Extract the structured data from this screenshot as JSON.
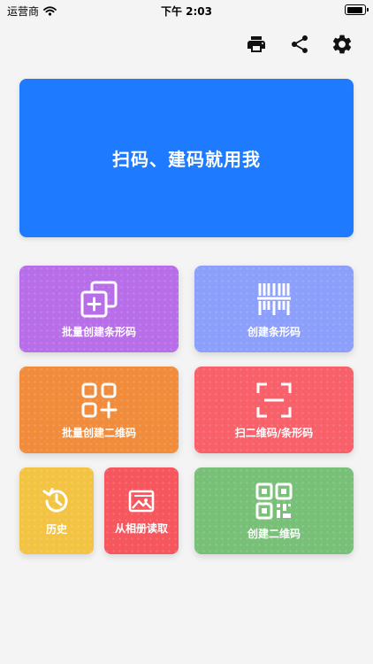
{
  "status_bar": {
    "carrier": "运营商",
    "time": "下午 2:03",
    "battery_level": 0.9
  },
  "toolbar": {
    "icons": [
      "print-icon",
      "share-icon",
      "settings-icon"
    ]
  },
  "hero": {
    "title": "扫码、建码就用我",
    "color": "#1e7bff"
  },
  "tiles": [
    {
      "label": "批量创建条形码",
      "icon": "batch-barcode-icon",
      "color": "#b86ee8"
    },
    {
      "label": "创建条形码",
      "icon": "barcode-icon",
      "color": "#8b9ffb"
    },
    {
      "label": "批量创建二维码",
      "icon": "batch-qrcode-icon",
      "color": "#f08c3b"
    },
    {
      "label": "扫二维码/条形码",
      "icon": "scan-icon",
      "color": "#f8606a"
    },
    {
      "label": "历史",
      "icon": "history-icon",
      "color": "#f3c443"
    },
    {
      "label": "从相册读取",
      "icon": "album-icon",
      "color": "#f6565d"
    },
    {
      "label": "创建二维码",
      "icon": "qrcode-icon",
      "color": "#78bf78"
    }
  ]
}
